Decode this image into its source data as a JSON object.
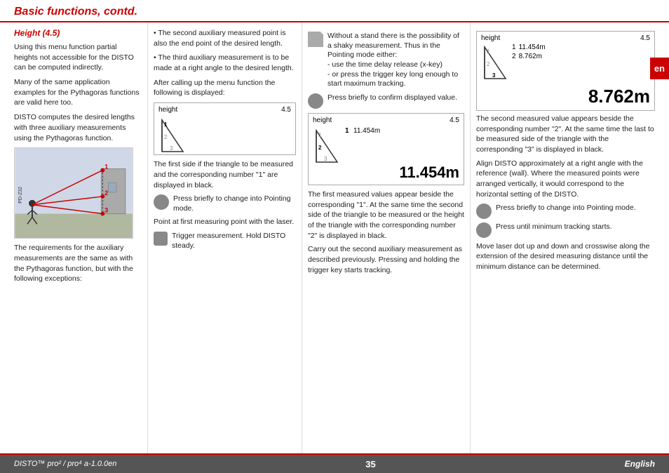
{
  "header": {
    "title": "Basic functions, contd."
  },
  "section": {
    "subtitle": "Height (4.5)"
  },
  "col_left": {
    "p1": "Using this menu function partial heights not accessible  for the DISTO can be computed indirectly.",
    "p2": "Many of the same application examples for the  Pythagoras functions are valid here too.",
    "p3": "DISTO computes the desired lengths with three auxiliary measurements using the Pythagoras function.",
    "p4": "The requirements for the auxiliary measurements are the same as with the Pythagoras function, but with the following exceptions:"
  },
  "col_mid_left": {
    "intro": "After calling up the menu function the following is displayed:",
    "meas_box1": {
      "label": "height",
      "value": "4.5",
      "rows": [
        "1",
        "2",
        "3"
      ]
    },
    "p1": "The first side if the triangle to be measured and the corresponding number \"1\" are displayed in black.",
    "btn1_text": "Press briefly to change into Pointing mode.",
    "p2": "Point at first measuring point with the laser.",
    "btn2_text": "Trigger measurement. Hold DISTO steady."
  },
  "bullet_list": {
    "b1": "The second auxiliary measured point is also  the end point of the desired length.",
    "b2": "The third auxiliary measurement  is to be made at a right angle to the desired length."
  },
  "col_mid_right": {
    "meas_box2": {
      "label": "height",
      "value": "4.5",
      "row1_num": "1",
      "row1_val": "11.454m",
      "row2_num": "2",
      "row3_num": "3",
      "big_val": "11.454m"
    },
    "p1": "The first measured values appear beside the corresponding \"1\". At the same time the second side of the triangle to be measured or the height of the triangle with the corresponding number \"2\" is displayed in black.",
    "p2": "Carry out the second auxiliary measurement as described previously. Pressing and holding the trigger key starts tracking."
  },
  "note_text": "Without a stand there is the possibility of a shaky measurement. Thus in the Pointing mode either:\n- use the time delay release (x-key)\n- or press the trigger key long enough to start maximum tracking.",
  "confirm_text": "Press briefly to confirm displayed value.",
  "col_right": {
    "meas_box3": {
      "label": "height",
      "value": "4.5",
      "row1_num": "1",
      "row1_val": "11.454m",
      "row2_num": "2",
      "row2_val": "8.762m",
      "row3_num": "3",
      "big_val": "8.762m"
    },
    "p1": "The second measured value appears beside the corresponding number \"2\". At the same time the last to be measured side of the triangle with the corresponding \"3\" is displayed in black.",
    "p2": "Align DISTO approximately at a right angle with the reference (wall). Where the measured points were arranged vertically, it would correspond to the horizontal setting of the DISTO.",
    "btn1_text": "Press briefly to change into Pointing mode.",
    "btn2_text": "Press until minimum tracking starts.",
    "p3": "Move laser dot up and down and crosswise along the extension of  the desired measuring distance until the minimum distance can be determined."
  },
  "footer": {
    "left": "DISTO™  pro² / pro⁴ a-1.0.0en",
    "center": "35",
    "right": "English"
  }
}
